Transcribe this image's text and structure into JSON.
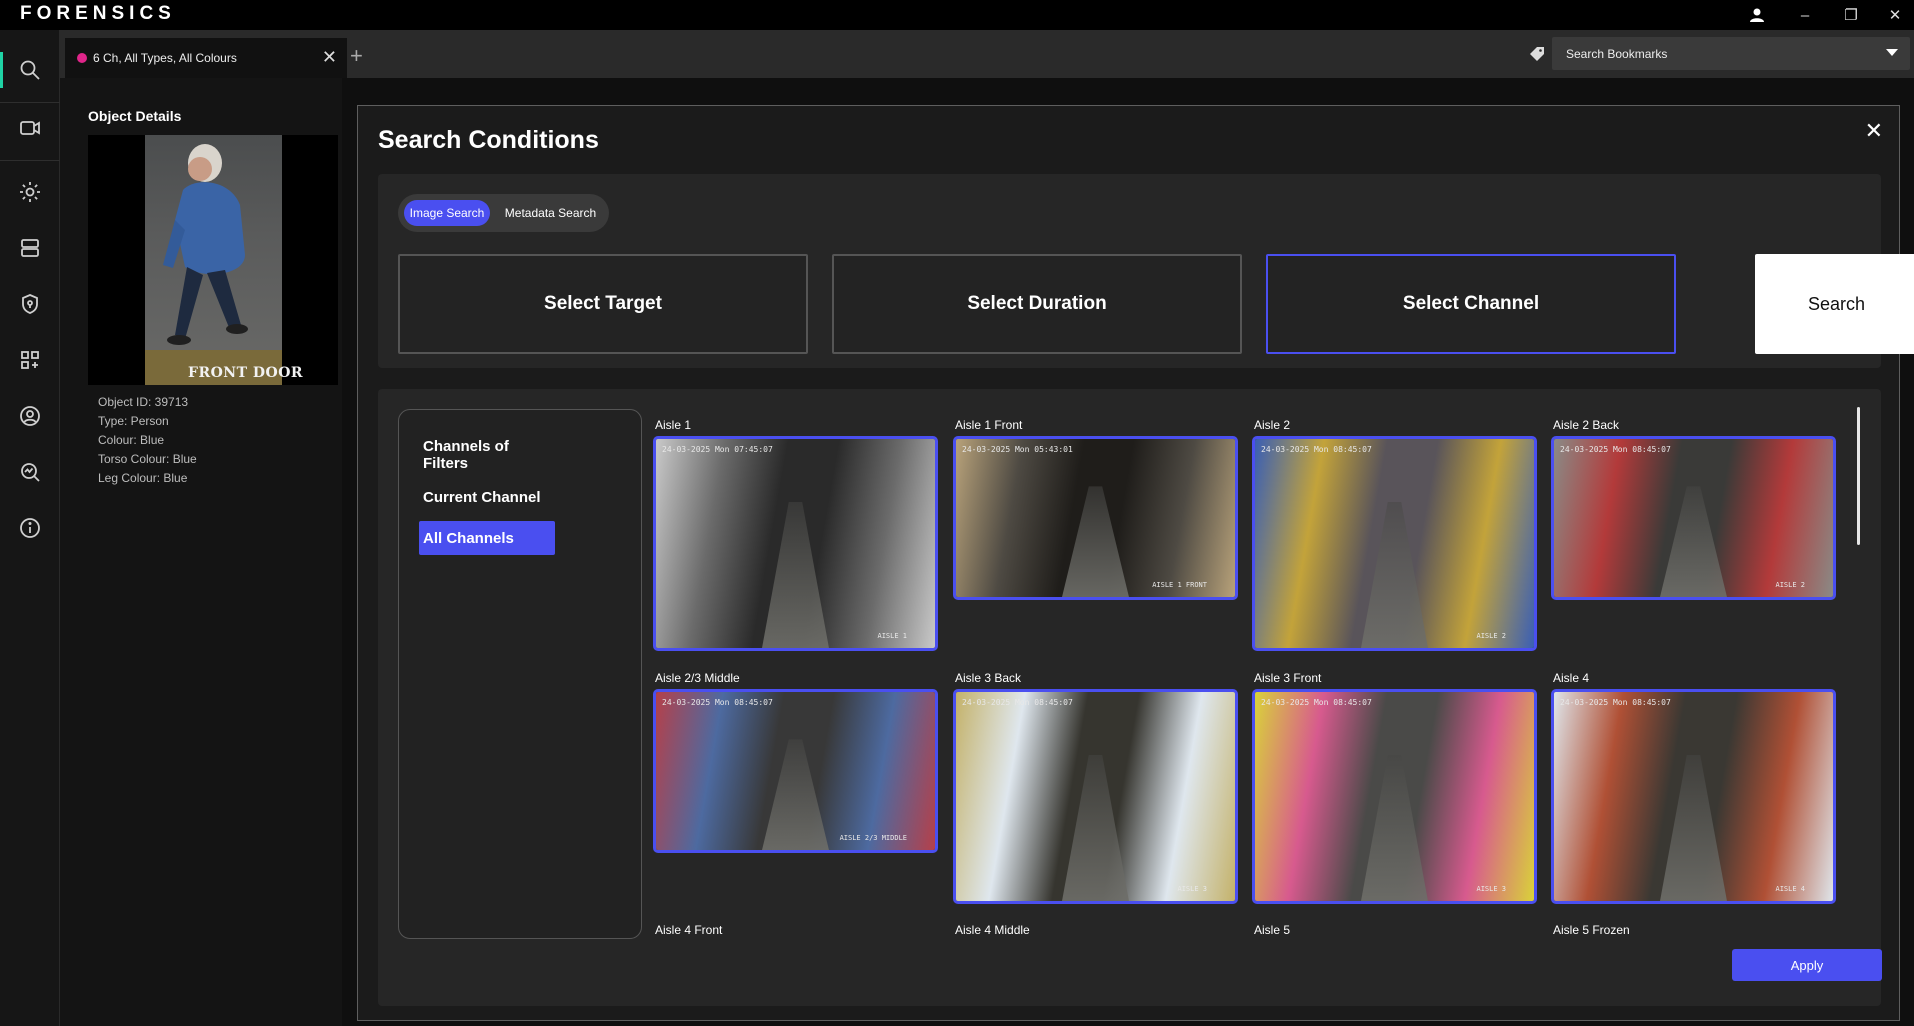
{
  "app": {
    "brand": "FORENSICS"
  },
  "window_controls": {
    "user": "user-icon",
    "minimize": "–",
    "restore": "❐",
    "close": "✕"
  },
  "tabs": [
    {
      "label": "6 Ch, All Types, All Colours",
      "dot_color": "#e0258a"
    }
  ],
  "bookmarks": {
    "placeholder": "Search Bookmarks"
  },
  "object_details": {
    "title": "Object Details",
    "image_caption": "FRONT DOOR",
    "fields": [
      "Object ID: 39713",
      "Type: Person",
      "Colour: Blue",
      "Torso Colour: Blue",
      "Leg Colour: Blue"
    ]
  },
  "search_conditions": {
    "title": "Search Conditions",
    "modes": {
      "active": "Image Search",
      "inactive": "Metadata Search"
    },
    "select_target": "Select Target",
    "select_duration": "Select Duration",
    "select_channel": "Select Channel",
    "search": "Search"
  },
  "filters": {
    "items": [
      "Channels of Filters",
      "Current Channel",
      "All Channels"
    ],
    "selected": "All Channels"
  },
  "channels": [
    {
      "name": "Aisle 1",
      "timestamp": "24-03-2025 Mon 07:45:07",
      "tag": "AISLE 1",
      "colors": [
        "#c9c9c9",
        "#6b6b6b",
        "#2a2a2a"
      ]
    },
    {
      "name": "Aisle 1 Front",
      "timestamp": "24-03-2025 Mon 05:43:01",
      "tag": "AISLE 1 FRONT",
      "colors": [
        "#b8a27a",
        "#4e4a43",
        "#1f1d1a"
      ]
    },
    {
      "name": "Aisle 2",
      "timestamp": "24-03-2025 Mon 08:45:07",
      "tag": "AISLE 2",
      "colors": [
        "#3a5fb5",
        "#c3a33a",
        "#59545a"
      ]
    },
    {
      "name": "Aisle 2 Back",
      "timestamp": "24-03-2025 Mon 08:45:07",
      "tag": "AISLE 2",
      "colors": [
        "#8a8a86",
        "#b33a3a",
        "#3a3a38"
      ]
    },
    {
      "name": "Aisle 2/3 Middle",
      "timestamp": "24-03-2025 Mon 08:45:07",
      "tag": "AISLE 2/3 MIDDLE",
      "colors": [
        "#b5404a",
        "#4d6aa0",
        "#383838"
      ]
    },
    {
      "name": "Aisle 3 Back",
      "timestamp": "24-03-2025 Mon 08:45:07",
      "tag": "AISLE 3",
      "colors": [
        "#c4b26a",
        "#dfe7ee",
        "#36352f"
      ]
    },
    {
      "name": "Aisle 3 Front",
      "timestamp": "24-03-2025 Mon 08:45:07",
      "tag": "AISLE 3",
      "colors": [
        "#d9d23a",
        "#d75a8e",
        "#4a4a48"
      ]
    },
    {
      "name": "Aisle 4",
      "timestamp": "24-03-2025 Mon 08:45:07",
      "tag": "AISLE 4",
      "colors": [
        "#dfe5ea",
        "#b05035",
        "#3a3833"
      ]
    },
    {
      "name": "Aisle 4 Front"
    },
    {
      "name": "Aisle 4 Middle"
    },
    {
      "name": "Aisle 5"
    },
    {
      "name": "Aisle 5 Frozen"
    }
  ],
  "apply": "Apply",
  "accent_color": "#4a4ff0"
}
